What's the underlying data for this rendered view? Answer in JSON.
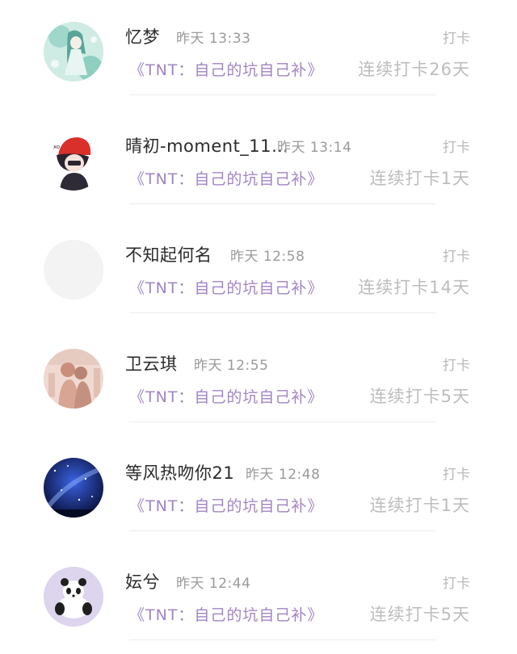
{
  "feed": {
    "items": [
      {
        "name": "忆梦",
        "time": "昨天 13:33",
        "action": "打卡",
        "book": "《TNT：自己的坑自己补》",
        "streak": "连续打卡26天",
        "avatar": "anime-girl-avatar"
      },
      {
        "name": "晴初-moment_11…",
        "time": "昨天 13:14",
        "action": "打卡",
        "book": "《TNT：自己的坑自己补》",
        "streak": "连续打卡1天",
        "avatar": "red-hat-boy-avatar"
      },
      {
        "name": "不知起何名",
        "time": "昨天 12:58",
        "action": "打卡",
        "book": "《TNT：自己的坑自己补》",
        "streak": "连续打卡14天",
        "avatar": "blank-avatar"
      },
      {
        "name": "卫云琪",
        "time": "昨天 12:55",
        "action": "打卡",
        "book": "《TNT：自己的坑自己补》",
        "streak": "连续打卡5天",
        "avatar": "couple-illustration-avatar"
      },
      {
        "name": "等风热吻你21",
        "time": "昨天 12:48",
        "action": "打卡",
        "book": "《TNT：自己的坑自己补》",
        "streak": "连续打卡1天",
        "avatar": "starry-sky-avatar"
      },
      {
        "name": "妘兮",
        "time": "昨天 12:44",
        "action": "打卡",
        "book": "《TNT：自己的坑自己补》",
        "streak": "连续打卡5天",
        "avatar": "panda-avatar"
      }
    ]
  }
}
